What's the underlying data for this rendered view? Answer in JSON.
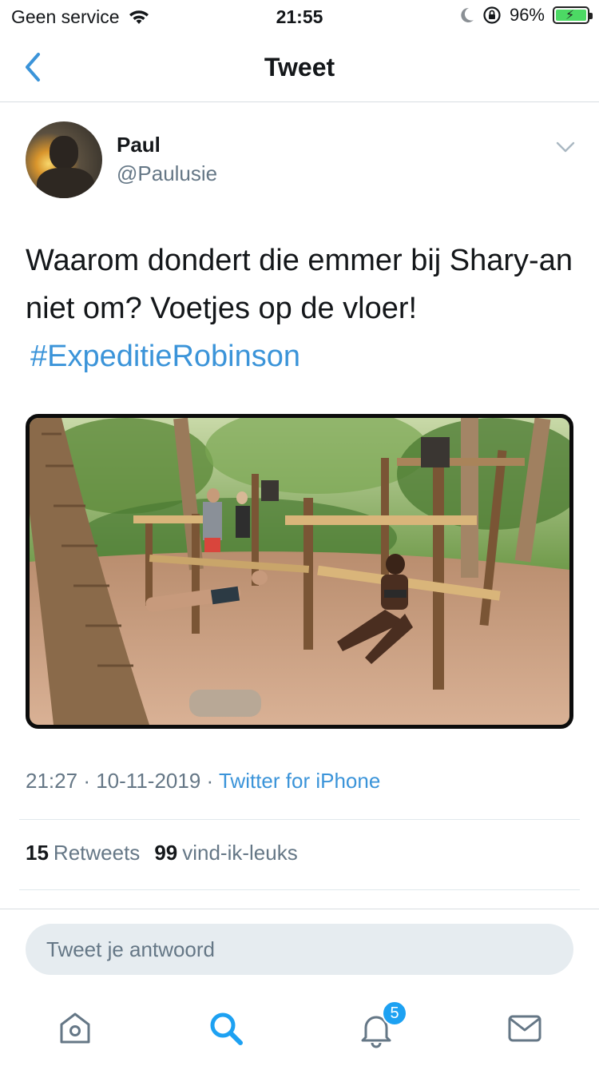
{
  "status_bar": {
    "carrier": "Geen service",
    "time": "21:55",
    "battery": "96%",
    "icons": [
      "wifi-icon",
      "moon-icon",
      "orientation-lock-icon",
      "battery-charging-icon"
    ]
  },
  "nav": {
    "title": "Tweet",
    "back_icon": "chevron-left-icon"
  },
  "tweet": {
    "author_name": "Paul",
    "author_handle": "@Paulusie",
    "text": "Waarom dondert die emmer bij Shary-an niet om? Voetjes op de vloer!",
    "hashtag": "#ExpeditieRobinson",
    "time": "21:27",
    "date": "10-11-2019",
    "source": "Twitter for iPhone",
    "separator": "·",
    "retweets_count": "15",
    "retweets_label": "Retweets",
    "likes_count": "99",
    "likes_label": "vind-ik-leuks"
  },
  "reply": {
    "placeholder": "Tweet je antwoord"
  },
  "tabbar": {
    "items": [
      "home-icon",
      "search-icon",
      "notifications-icon",
      "messages-icon"
    ],
    "notifications_badge": "5"
  },
  "colors": {
    "accent": "#3b94d9",
    "text_primary": "#14171a",
    "text_secondary": "#657786",
    "input_bg": "#e6ecf0"
  }
}
